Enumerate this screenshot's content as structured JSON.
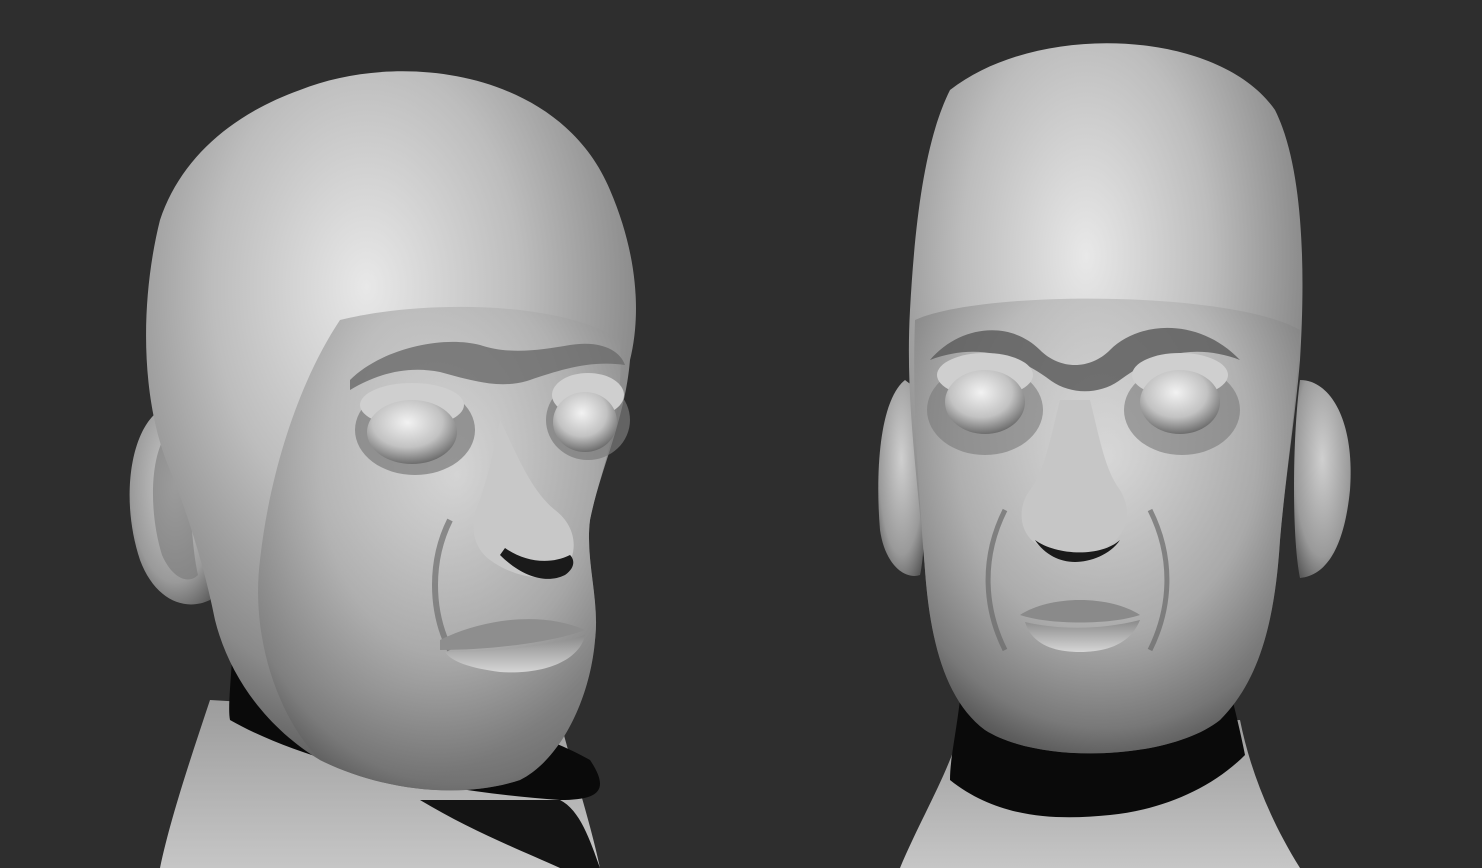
{
  "scene": {
    "background_color": "#2e2e2e",
    "clay_base_color": "#a9a9a9",
    "clay_highlight_color": "#e6e6e6",
    "clay_shadow_color": "#3a3a3a",
    "cast_shadow_color": "#0a0a0a",
    "views": [
      {
        "name": "three-quarter-view",
        "icon": "sculpt-head-icon"
      },
      {
        "name": "front-view",
        "icon": "sculpt-head-icon"
      }
    ]
  }
}
